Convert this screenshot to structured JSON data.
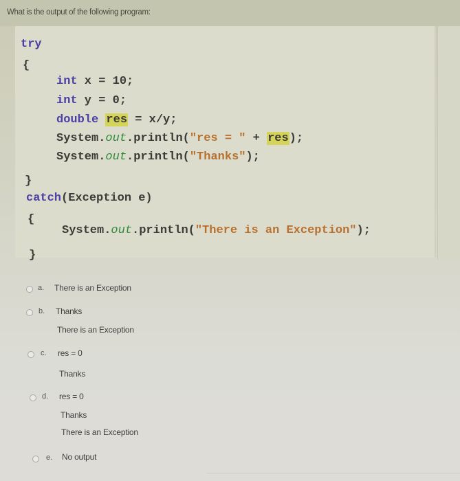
{
  "question": {
    "text": "What is the output of the following program:"
  },
  "code": {
    "try_kw": "try",
    "open_brace_1": "{",
    "line1": {
      "type": "int",
      "rest": " x = 10;"
    },
    "line2": {
      "type": "int",
      "rest": " y = 0;"
    },
    "line3": {
      "type": "double",
      "var": "res",
      "rest": " = x/y;"
    },
    "line4": {
      "obj": "System.",
      "field": "out",
      "call": ".println(",
      "str": "\"res = \"",
      "plus": " + ",
      "var": "res",
      "end": ");"
    },
    "line5": {
      "obj": "System.",
      "field": "out",
      "call": ".println(",
      "str": "\"Thanks\"",
      "end": ");"
    },
    "close_brace_1": "}",
    "catch_kw": "catch",
    "catch_rest": "(Exception e)",
    "open_brace_2": "{",
    "line6": {
      "obj": "System.",
      "field": "out",
      "call": ".println(",
      "str": "\"There is an Exception\"",
      "end": ");"
    },
    "close_brace_2": "}"
  },
  "options": [
    {
      "letter": "a.",
      "lines": [
        "There is an Exception"
      ]
    },
    {
      "letter": "b.",
      "lines": [
        "Thanks",
        "There is an Exception"
      ]
    },
    {
      "letter": "c.",
      "lines": [
        "res = 0",
        "Thanks"
      ]
    },
    {
      "letter": "d.",
      "lines": [
        "res = 0",
        "Thanks",
        "There is an Exception"
      ]
    },
    {
      "letter": "e.",
      "lines": [
        "No output"
      ]
    }
  ],
  "colors": {
    "keyword": "#4b3fa8",
    "field": "#2f8a3a",
    "string": "#b8702f",
    "highlight": "#d4d45a"
  }
}
